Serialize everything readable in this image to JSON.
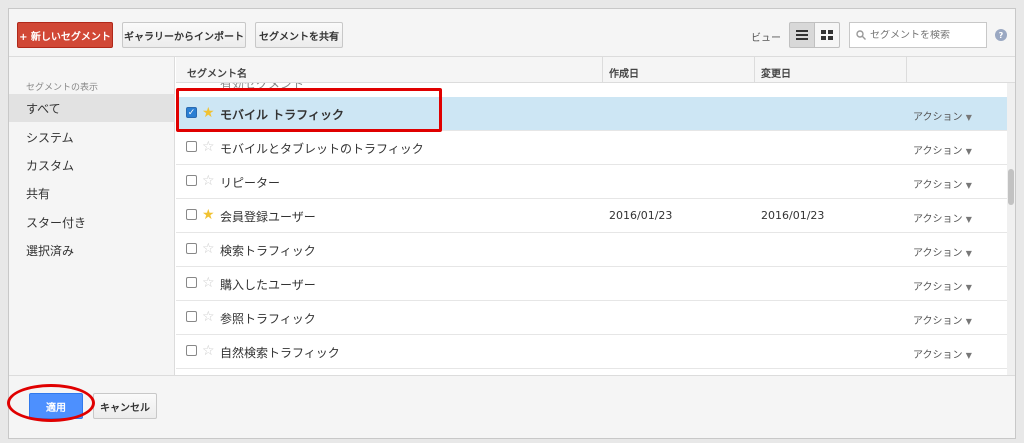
{
  "toolbar": {
    "new_segment_label": "+ 新しいセグメント",
    "import_gallery_label": "ギャラリーからインポート",
    "share_segment_label": "セグメントを共有",
    "view_label": "ビュー",
    "search_placeholder": "セグメントを検索",
    "help_label": "?"
  },
  "sidebar": {
    "title": "セグメントの表示",
    "items": [
      {
        "label": "すべて",
        "active": true
      },
      {
        "label": "システム"
      },
      {
        "label": "カスタム"
      },
      {
        "label": "共有"
      },
      {
        "label": "スター付き"
      },
      {
        "label": "選択済み"
      }
    ]
  },
  "table": {
    "columns": {
      "name": "セグメント名",
      "created": "作成日",
      "changed": "変更日"
    },
    "partial_row_label": "有効セグメント",
    "rows": [
      {
        "name": "モバイル トラフィック",
        "checked": true,
        "starred": true,
        "created": "",
        "changed": "",
        "action": "アクション"
      },
      {
        "name": "モバイルとタブレットのトラフィック",
        "checked": false,
        "starred": false,
        "created": "",
        "changed": "",
        "action": "アクション"
      },
      {
        "name": "リピーター",
        "checked": false,
        "starred": false,
        "created": "",
        "changed": "",
        "action": "アクション"
      },
      {
        "name": "会員登録ユーザー",
        "checked": false,
        "starred": true,
        "created": "2016/01/23",
        "changed": "2016/01/23",
        "action": "アクション"
      },
      {
        "name": "検索トラフィック",
        "checked": false,
        "starred": false,
        "created": "",
        "changed": "",
        "action": "アクション"
      },
      {
        "name": "購入したユーザー",
        "checked": false,
        "starred": false,
        "created": "",
        "changed": "",
        "action": "アクション"
      },
      {
        "name": "参照トラフィック",
        "checked": false,
        "starred": false,
        "created": "",
        "changed": "",
        "action": "アクション"
      },
      {
        "name": "自然検索トラフィック",
        "checked": false,
        "starred": false,
        "created": "",
        "changed": "",
        "action": "アクション"
      }
    ]
  },
  "footer": {
    "apply_label": "適用",
    "cancel_label": "キャンセル"
  },
  "colors": {
    "new_button": "#d14836",
    "apply_button": "#4d90fe",
    "selected_row": "#cde6f4",
    "star_on": "#f1c232",
    "highlight_annotation": "#e00000"
  }
}
